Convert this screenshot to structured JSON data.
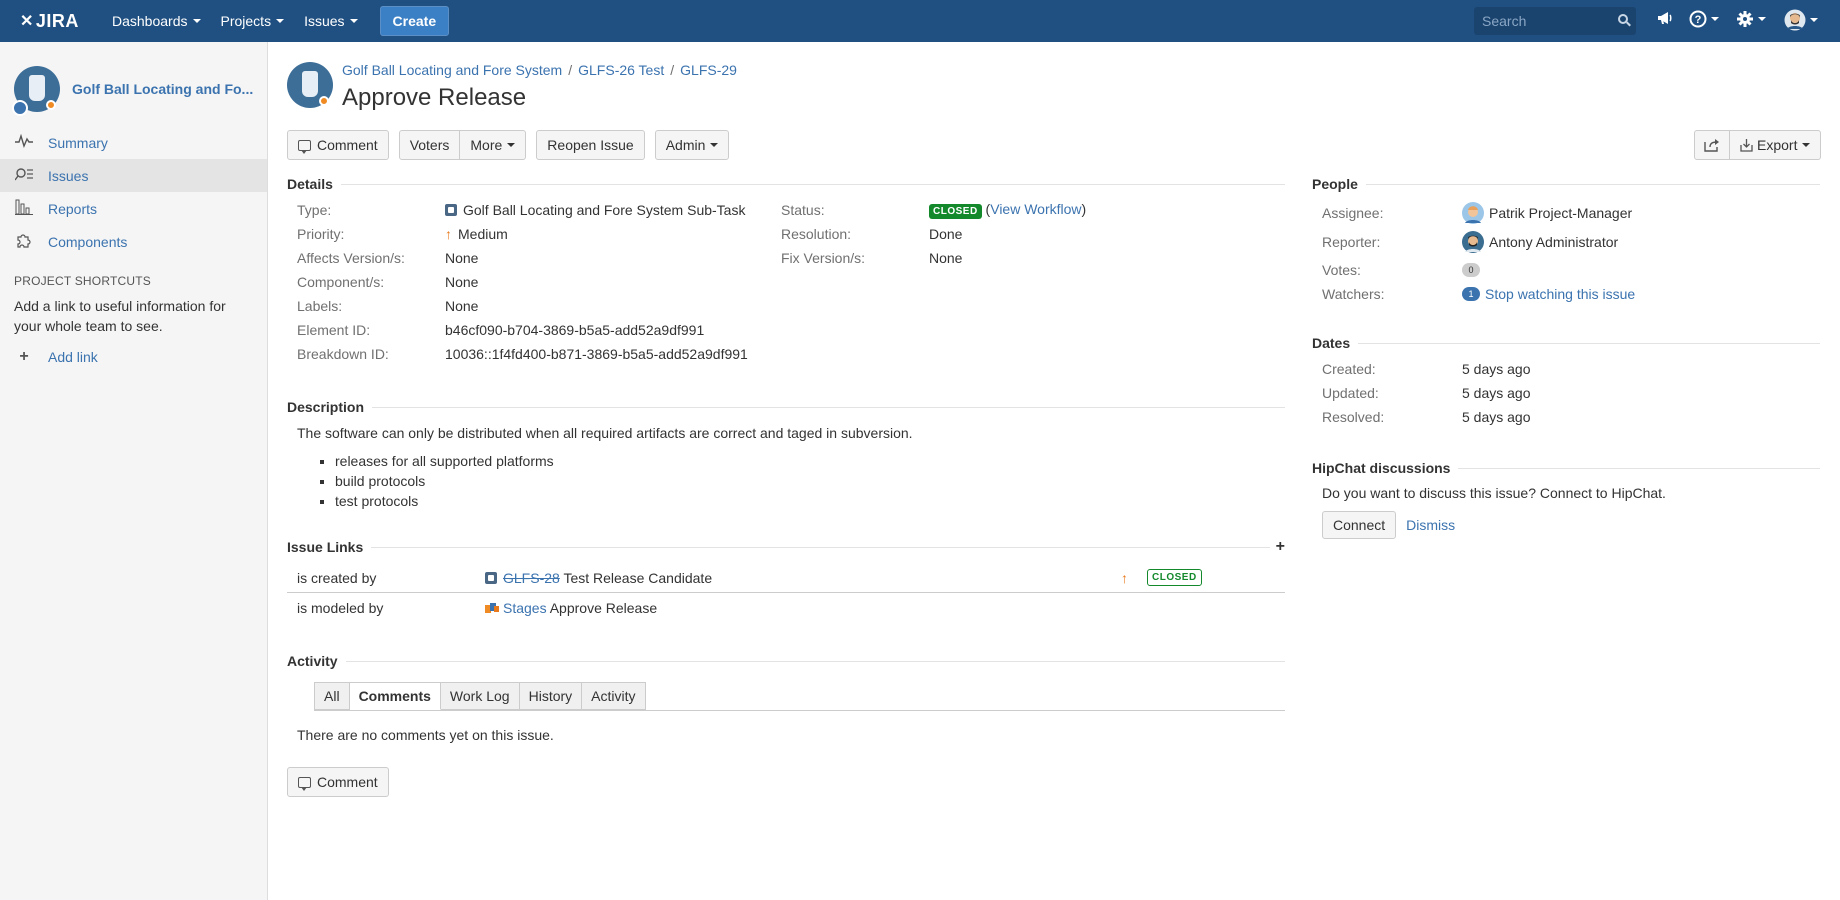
{
  "topbar": {
    "logo": "JIRA",
    "nav": [
      {
        "label": "Dashboards"
      },
      {
        "label": "Projects"
      },
      {
        "label": "Issues"
      }
    ],
    "create_label": "Create",
    "search_placeholder": "Search"
  },
  "sidebar": {
    "project_name": "Golf Ball Locating and Fo...",
    "items": [
      {
        "label": "Summary",
        "icon": "pulse-icon"
      },
      {
        "label": "Issues",
        "icon": "issues-icon"
      },
      {
        "label": "Reports",
        "icon": "reports-icon"
      },
      {
        "label": "Components",
        "icon": "puzzle-icon"
      }
    ],
    "shortcuts_title": "PROJECT SHORTCUTS",
    "shortcuts_text": "Add a link to useful information for your whole team to see.",
    "add_link": "Add link"
  },
  "issue": {
    "breadcrumbs": [
      "Golf Ball Locating and Fore System",
      "GLFS-26 Test",
      "GLFS-29"
    ],
    "breadcrumb_sep": "/",
    "title": "Approve Release"
  },
  "toolbar": {
    "comment": "Comment",
    "voters": "Voters",
    "more": "More",
    "reopen": "Reopen Issue",
    "admin": "Admin",
    "export": "Export"
  },
  "details": {
    "title": "Details",
    "left": [
      {
        "label": "Type:",
        "value": "Golf Ball Locating and Fore System Sub-Task"
      },
      {
        "label": "Priority:",
        "value": "Medium"
      },
      {
        "label": "Affects Version/s:",
        "value": "None"
      },
      {
        "label": "Component/s:",
        "value": "None"
      },
      {
        "label": "Labels:",
        "value": "None"
      },
      {
        "label": "Element ID:",
        "value": "b46cf090-b704-3869-b5a5-add52a9df991"
      },
      {
        "label": "Breakdown ID:",
        "value": "10036::1f4fd400-b871-3869-b5a5-add52a9df991"
      }
    ],
    "right": [
      {
        "label": "Status:",
        "value": "CLOSED",
        "link": "View Workflow"
      },
      {
        "label": "Resolution:",
        "value": "Done"
      },
      {
        "label": "Fix Version/s:",
        "value": "None"
      }
    ]
  },
  "description": {
    "title": "Description",
    "text": "The software can only be distributed when all required artifacts are correct and taged in subversion.",
    "bullets": [
      "releases for all supported platforms",
      "build protocols",
      "test protocols"
    ]
  },
  "links": {
    "title": "Issue Links",
    "rows": [
      {
        "relation": "is created by",
        "key": "GLFS-28",
        "summary": "Test Release Candidate",
        "status": "CLOSED"
      },
      {
        "relation": "is modeled by",
        "key": "Stages",
        "summary": "Approve Release"
      }
    ]
  },
  "activity": {
    "title": "Activity",
    "tabs": [
      "All",
      "Comments",
      "Work Log",
      "History",
      "Activity"
    ],
    "empty": "There are no comments yet on this issue.",
    "comment_button": "Comment"
  },
  "people": {
    "title": "People",
    "assignee_label": "Assignee:",
    "assignee": "Patrik Project-Manager",
    "reporter_label": "Reporter:",
    "reporter": "Antony Administrator",
    "votes_label": "Votes:",
    "votes": "0",
    "watchers_label": "Watchers:",
    "watchers_count": "1",
    "watch_link": "Stop watching this issue"
  },
  "dates": {
    "title": "Dates",
    "rows": [
      {
        "label": "Created:",
        "value": "5 days ago"
      },
      {
        "label": "Updated:",
        "value": "5 days ago"
      },
      {
        "label": "Resolved:",
        "value": "5 days ago"
      }
    ]
  },
  "hipchat": {
    "title": "HipChat discussions",
    "text": "Do you want to discuss this issue? Connect to HipChat.",
    "connect": "Connect",
    "dismiss": "Dismiss"
  },
  "colors": {
    "header": "#205081",
    "link": "#3b73af",
    "closed": "#14892c",
    "priority": "#e87a1c"
  }
}
